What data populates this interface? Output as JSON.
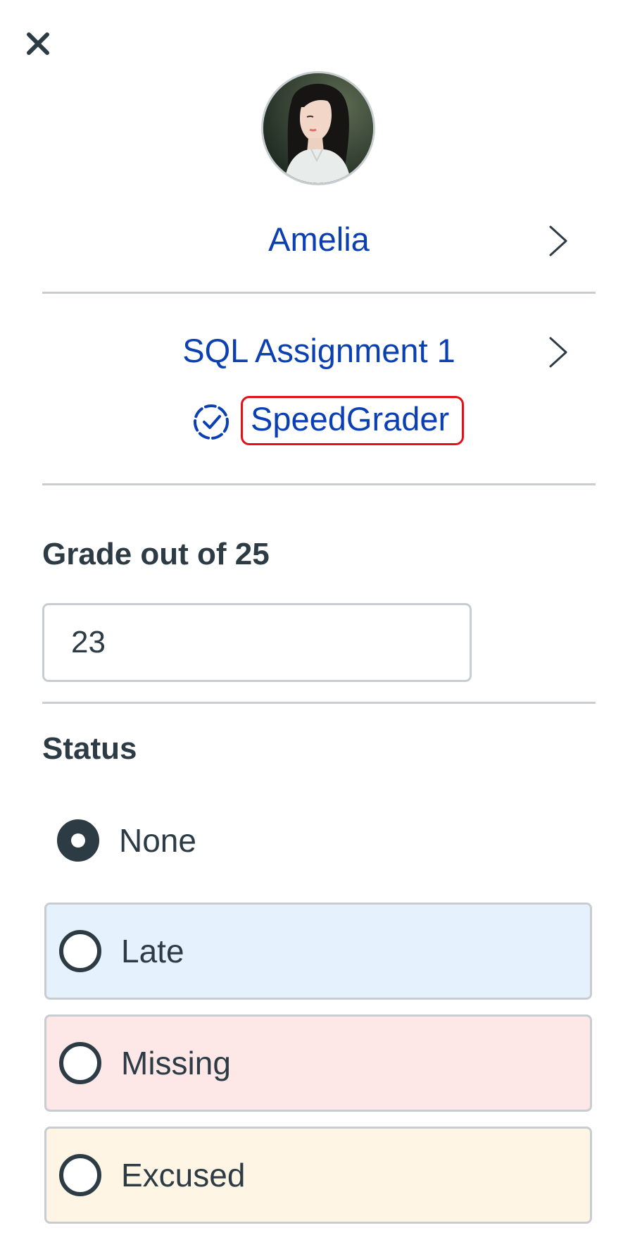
{
  "header": {
    "close_label": "Close"
  },
  "student": {
    "name": "Amelia",
    "avatar_alt": "Amelia avatar"
  },
  "assignment": {
    "title": "SQL Assignment 1",
    "speedgrader_label": "SpeedGrader"
  },
  "grade": {
    "label": "Grade out of 25",
    "value": "23"
  },
  "status": {
    "label": "Status",
    "options": [
      {
        "label": "None",
        "selected": true
      },
      {
        "label": "Late",
        "selected": false,
        "color": "#e5f2fd"
      },
      {
        "label": "Missing",
        "selected": false,
        "color": "#fde7e7"
      },
      {
        "label": "Excused",
        "selected": false,
        "color": "#fef5e4"
      }
    ]
  },
  "colors": {
    "link": "#0b3fb4",
    "text": "#2d3b45",
    "divider": "#c7cdd1",
    "highlight_border": "#e3101a"
  }
}
